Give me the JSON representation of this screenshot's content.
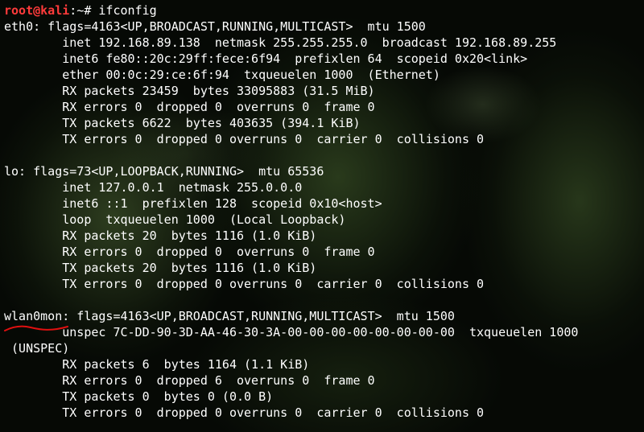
{
  "prompt": {
    "user_host": "root@kali",
    "path": ":~#",
    "command": " ifconfig"
  },
  "lines": [
    "eth0: flags=4163<UP,BROADCAST,RUNNING,MULTICAST>  mtu 1500",
    "        inet 192.168.89.138  netmask 255.255.255.0  broadcast 192.168.89.255",
    "        inet6 fe80::20c:29ff:fece:6f94  prefixlen 64  scopeid 0x20<link>",
    "        ether 00:0c:29:ce:6f:94  txqueuelen 1000  (Ethernet)",
    "        RX packets 23459  bytes 33095883 (31.5 MiB)",
    "        RX errors 0  dropped 0  overruns 0  frame 0",
    "        TX packets 6622  bytes 403635 (394.1 KiB)",
    "        TX errors 0  dropped 0 overruns 0  carrier 0  collisions 0",
    "",
    "lo: flags=73<UP,LOOPBACK,RUNNING>  mtu 65536",
    "        inet 127.0.0.1  netmask 255.0.0.0",
    "        inet6 ::1  prefixlen 128  scopeid 0x10<host>",
    "        loop  txqueuelen 1000  (Local Loopback)",
    "        RX packets 20  bytes 1116 (1.0 KiB)",
    "        RX errors 0  dropped 0  overruns 0  frame 0",
    "        TX packets 20  bytes 1116 (1.0 KiB)",
    "        TX errors 0  dropped 0 overruns 0  carrier 0  collisions 0",
    "",
    "wlan0mon: flags=4163<UP,BROADCAST,RUNNING,MULTICAST>  mtu 1500",
    "        unspec 7C-DD-90-3D-AA-46-30-3A-00-00-00-00-00-00-00-00  txqueuelen 1000",
    " (UNSPEC)",
    "        RX packets 6  bytes 1164 (1.1 KiB)",
    "        RX errors 0  dropped 6  overruns 0  frame 0",
    "        TX packets 0  bytes 0 (0.0 B)",
    "        TX errors 0  dropped 0 overruns 0  carrier 0  collisions 0"
  ],
  "colors": {
    "prompt_user": "#ff3b3b",
    "text": "#ffffff",
    "annotation": "#e01010"
  }
}
